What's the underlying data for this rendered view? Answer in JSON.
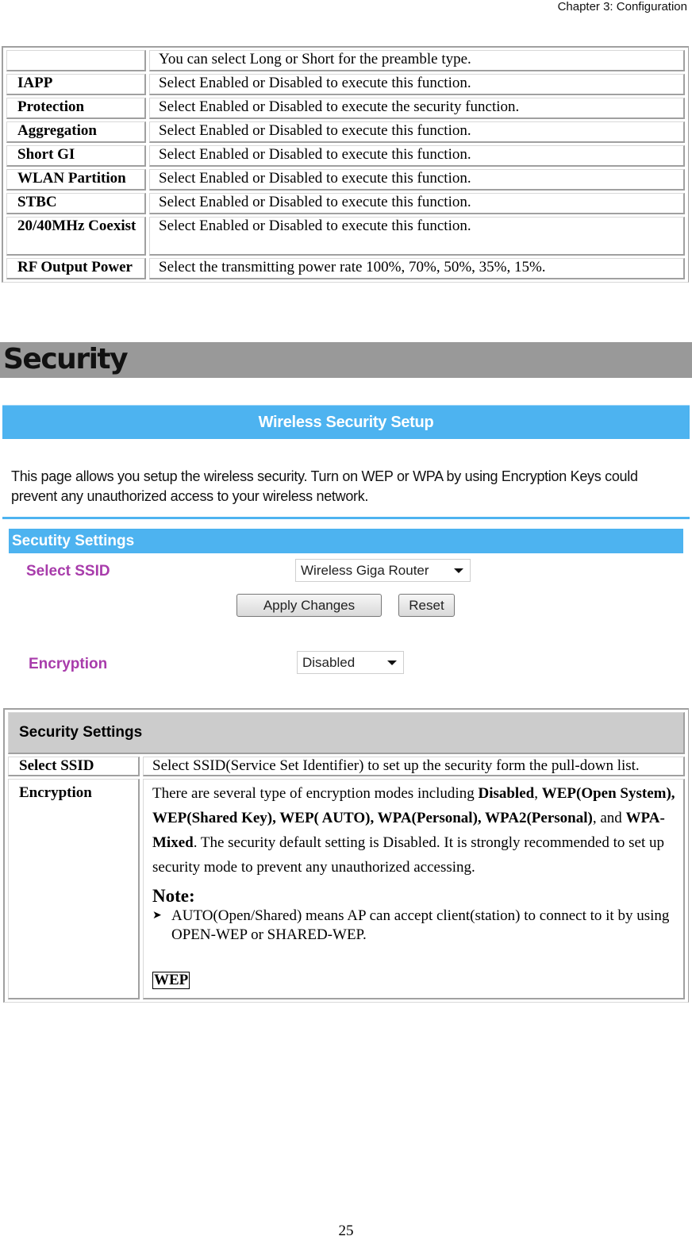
{
  "header": {
    "chapter": "Chapter 3: Configuration"
  },
  "table1": {
    "rows": [
      {
        "key": "",
        "value": "You can select Long or Short for the preamble type."
      },
      {
        "key": "IAPP",
        "value": "Select Enabled or Disabled to execute this function."
      },
      {
        "key": "Protection",
        "value": "Select Enabled or Disabled to execute the security function."
      },
      {
        "key": "Aggregation",
        "value": "Select Enabled or Disabled to execute this function."
      },
      {
        "key": "Short GI",
        "value": "Select Enabled or Disabled to execute this function."
      },
      {
        "key": "WLAN Partition",
        "value": "Select Enabled or Disabled to execute this function."
      },
      {
        "key": "STBC",
        "value": "Select Enabled or Disabled to execute this function."
      },
      {
        "key": "20/40MHz Coexist",
        "value": "Select Enabled or Disabled to execute this function."
      },
      {
        "key": "RF Output Power",
        "value": "Select the transmitting power rate 100%, 70%, 50%, 35%, 15%."
      }
    ]
  },
  "section": {
    "title": "Security"
  },
  "screenshot": {
    "title": "Wireless Security Setup",
    "description": "This page allows you setup the wireless security. Turn on WEP or WPA by using Encryption Keys could prevent any unauthorized access to your wireless network.",
    "subheader": "Secutity Settings",
    "select_ssid_label": "Select SSID",
    "ssid_value": "Wireless Giga Router",
    "apply_button": "Apply Changes",
    "reset_button": "Reset",
    "encryption_label": "Encryption",
    "encryption_value": "Disabled",
    "accent_color": "#4db3f0",
    "label_color": "#a83cab"
  },
  "table2": {
    "header": "Security Settings",
    "select_ssid": {
      "key": "Select SSID",
      "value": "Select SSID(Service Set Identifier) to set up the security form the pull-down list."
    },
    "encryption": {
      "key": "Encryption",
      "desc_parts": {
        "p1": "There are several type of encryption modes including ",
        "b1": "Disabled",
        "p2": ", ",
        "b2": "WEP(Open System), WEP(Shared Key), WEP( AUTO), WPA(Personal), WPA2(Personal)",
        "p3": ", and ",
        "b3": "WPA-Mixed",
        "p4": ". The security default setting is Disabled. It is strongly recommended to set up security mode to prevent any unauthorized accessing."
      },
      "note_title": "Note:",
      "note_bullet": "AUTO(Open/Shared) means AP can accept client(station) to connect to it by using OPEN-WEP or SHARED-WEP.",
      "wep_tag": "WEP"
    }
  },
  "footer": {
    "page_number": "25"
  }
}
